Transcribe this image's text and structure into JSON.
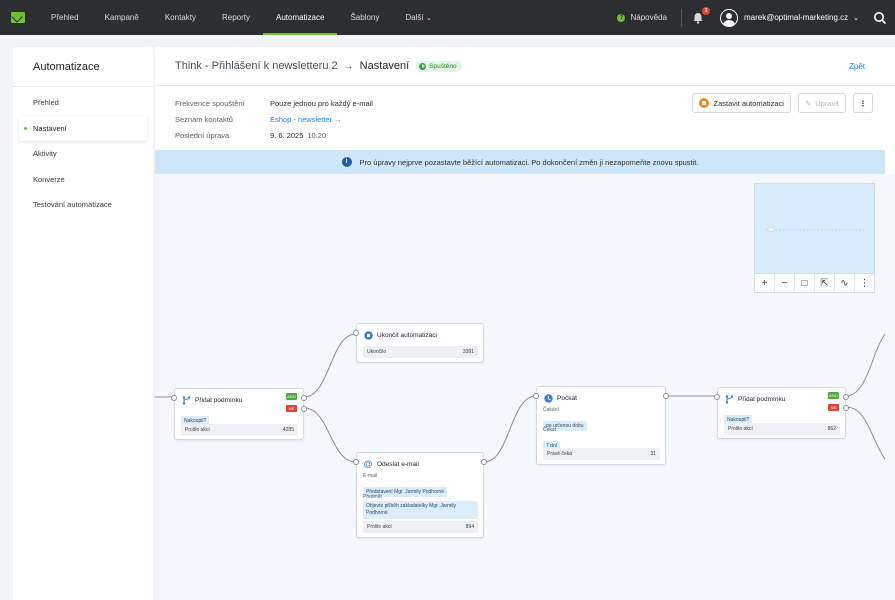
{
  "nav": {
    "items": [
      "Přehled",
      "Kampaně",
      "Kontakty",
      "Reporty",
      "Automatizace",
      "Šablony",
      "Další"
    ],
    "help": "Nápověda",
    "notifications": "3",
    "user_email": "marek@optimal-marketing.cz",
    "accent": "#6fbe33"
  },
  "sidebar": {
    "title": "Automatizace",
    "items": [
      "Přehled",
      "Nastavení",
      "Aktivity",
      "Konverze",
      "Testování automatizace"
    ]
  },
  "header": {
    "title": "Think - Přihlášení k newsletteru 2",
    "arrow": "→",
    "section": "Nastavení",
    "status": "Spuštěno",
    "back": "Zpět"
  },
  "info": {
    "frequency_label": "Frekvence spouštění",
    "frequency_value": "Pouze jednou pro každý e-mail",
    "list_label": "Seznam kontaktů",
    "list_value": "Eshop - newsletter",
    "list_arrow": "→",
    "updated_label": "Poslední úprava",
    "updated_date": "9. 6. 2025",
    "updated_time": "10:20"
  },
  "actions": {
    "stop": "Zastavit automatizaci",
    "edit": "Upravit",
    "more": "⋮"
  },
  "notice": {
    "icon": "i",
    "text": "Pro úpravy nejprve pozastavte běžící automatizaci. Po dokončení změn ji nezapomeňte znovu spustit."
  },
  "minimap": {
    "tools": [
      "+",
      "−",
      "□",
      "⇱",
      "∿",
      "⋮"
    ]
  },
  "nodes": {
    "condition1": {
      "title": "Přidat podmínku",
      "chip": "Nakoupil?",
      "yes": "ANO",
      "no": "NE",
      "stat_label": "Prošlo akcí",
      "stat_value": "4285"
    },
    "end": {
      "title": "Ukončit automatizaci",
      "stat_label": "Ukončilo",
      "stat_value": "3391"
    },
    "email": {
      "title": "Odeslat e-mail",
      "email_label": "E-mail",
      "email_value": "Představení Mgr. Jarmily Podhorné",
      "subject_label": "Předmět",
      "subject_value": "Objevte příběh zakladatelky Mgr. Jarmily Podhorné",
      "stat_label": "Prošlo akcí",
      "stat_value": "894"
    },
    "wait": {
      "title": "Počkat",
      "wait_label": "Čekání",
      "wait_value": "po určenou dobu",
      "wait2_label": "Čekat",
      "wait2_value": "7 dní",
      "stat_label": "Právě čeká",
      "stat_value": "31"
    },
    "condition2": {
      "title": "Přidat podmínku",
      "chip": "Nakoupil?",
      "yes": "ANO",
      "no": "NE",
      "stat_label": "Prošlo akcí",
      "stat_value": "862"
    }
  }
}
